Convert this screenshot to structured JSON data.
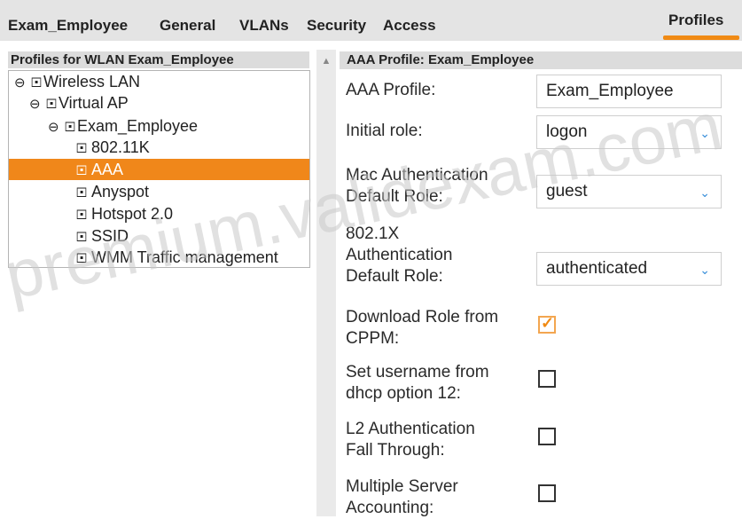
{
  "tabs": [
    {
      "label": "Exam_Employee"
    },
    {
      "label": "General"
    },
    {
      "label": "VLANs"
    },
    {
      "label": "Security"
    },
    {
      "label": "Access"
    },
    {
      "label": "Profiles",
      "active": true
    }
  ],
  "left_panel": {
    "title": "Profiles for WLAN Exam_Employee",
    "tree": [
      {
        "label": "Wireless LAN",
        "icons": "⊖🞔"
      },
      {
        "label": "Virtual AP",
        "icons": "⊖🞔"
      },
      {
        "label": "Exam_Employee",
        "icons": "⊖🞔"
      },
      {
        "label": "802.11K",
        "icons": "🞔"
      },
      {
        "label": "AAA",
        "icons": "🞔",
        "selected": true
      },
      {
        "label": "Anyspot",
        "icons": "🞔"
      },
      {
        "label": "Hotspot 2.0",
        "icons": "🞔"
      },
      {
        "label": "SSID",
        "icons": "🞔"
      },
      {
        "label": "WMM Traffic management",
        "icons": "🞔"
      }
    ]
  },
  "right_panel": {
    "title": "AAA Profile: Exam_Employee",
    "aaa_profile": {
      "label": "AAA Profile:",
      "value": "Exam_Employee"
    },
    "initial_role": {
      "label": "Initial role:",
      "value": "logon"
    },
    "mac_auth_role": {
      "label_line1": "Mac Authentication",
      "label_line2": "Default Role:",
      "value": "guest"
    },
    "dot1x_role": {
      "label_line1": "802.1X",
      "label_line2": "Authentication",
      "label_line3": "Default Role:",
      "value": "authenticated"
    },
    "download_role": {
      "label_line1": "Download Role from",
      "label_line2": "CPPM:",
      "checked": true
    },
    "set_username": {
      "label_line1": "Set username from",
      "label_line2": "dhcp option 12:",
      "checked": false
    },
    "l2_fall_through": {
      "label_line1": "L2 Authentication",
      "label_line2": "Fall Through:",
      "checked": false
    },
    "multiple_server": {
      "label_line1": "Multiple Server",
      "label_line2": "Accounting:",
      "checked": false
    }
  },
  "watermark": "premium.validexam.com",
  "colors": {
    "accent": "#f0871a",
    "dropdown_chevron": "#3a8fd9"
  }
}
